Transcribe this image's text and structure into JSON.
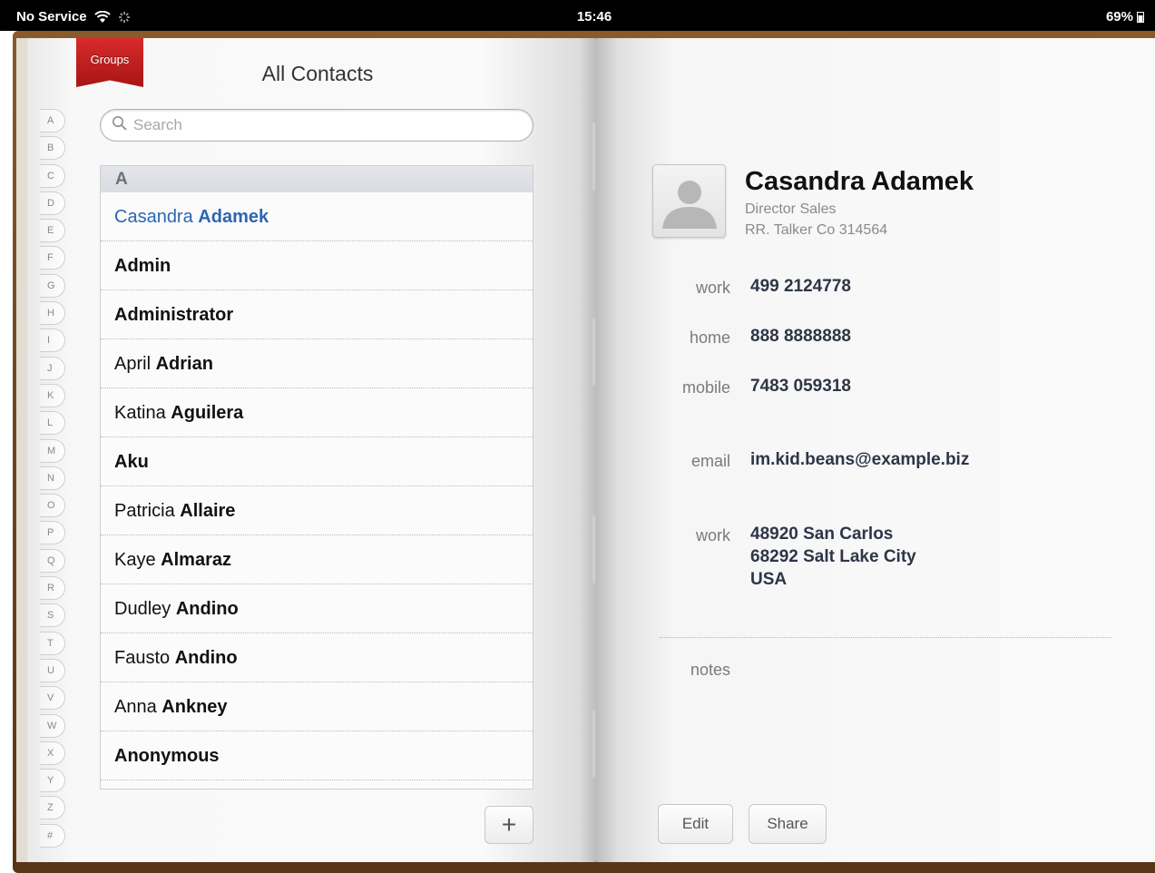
{
  "status_bar": {
    "carrier": "No Service",
    "time": "15:46",
    "battery": "69%"
  },
  "left_page": {
    "groups_label": "Groups",
    "title": "All Contacts",
    "search_placeholder": "Search",
    "index_letters": [
      "A",
      "B",
      "C",
      "D",
      "E",
      "F",
      "G",
      "H",
      "I",
      "J",
      "K",
      "L",
      "M",
      "N",
      "O",
      "P",
      "Q",
      "R",
      "S",
      "T",
      "U",
      "V",
      "W",
      "X",
      "Y",
      "Z",
      "#"
    ],
    "section_header": "A",
    "contacts": [
      {
        "first": "Casandra",
        "last": "Adamek",
        "selected": true
      },
      {
        "first": "",
        "last": "Admin",
        "selected": false
      },
      {
        "first": "",
        "last": "Administrator",
        "selected": false
      },
      {
        "first": "April",
        "last": "Adrian",
        "selected": false
      },
      {
        "first": "Katina",
        "last": "Aguilera",
        "selected": false
      },
      {
        "first": "",
        "last": "Aku",
        "selected": false
      },
      {
        "first": "Patricia",
        "last": "Allaire",
        "selected": false
      },
      {
        "first": "Kaye",
        "last": "Almaraz",
        "selected": false
      },
      {
        "first": "Dudley",
        "last": "Andino",
        "selected": false
      },
      {
        "first": "Fausto",
        "last": "Andino",
        "selected": false
      },
      {
        "first": "Anna",
        "last": "Ankney",
        "selected": false
      },
      {
        "first": "",
        "last": "Anonymous",
        "selected": false
      }
    ],
    "add_label": "+"
  },
  "detail": {
    "name": "Casandra Adamek",
    "job_title": "Director Sales",
    "company": "RR. Talker Co 314564",
    "phones": [
      {
        "label": "work",
        "value": "499 2124778"
      },
      {
        "label": "home",
        "value": "888 8888888"
      },
      {
        "label": "mobile",
        "value": "7483 059318"
      }
    ],
    "email": {
      "label": "email",
      "value": "im.kid.beans@example.biz"
    },
    "address": {
      "label": "work",
      "lines": [
        "48920 San Carlos",
        "68292 Salt Lake City",
        "USA"
      ]
    },
    "notes_label": "notes",
    "edit_label": "Edit",
    "share_label": "Share"
  },
  "colors": {
    "selected_contact": "#2b66b3",
    "ribbon": "#c21f1f",
    "value_text": "#2e3547"
  }
}
